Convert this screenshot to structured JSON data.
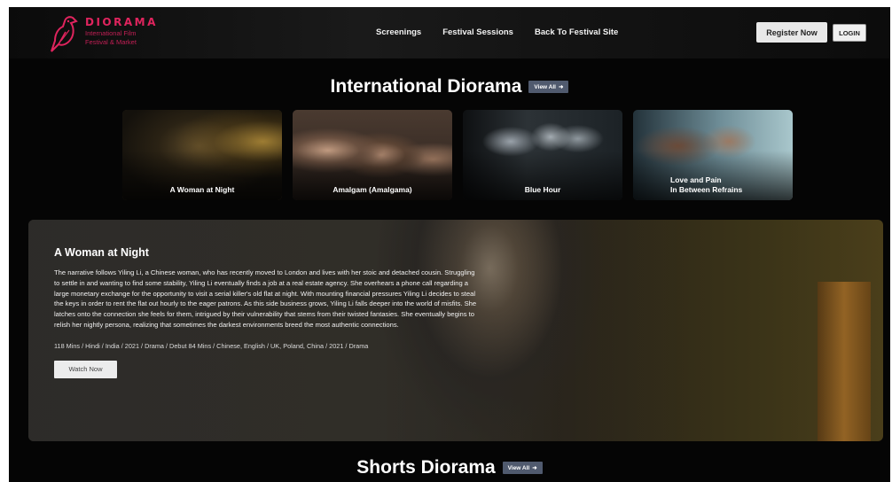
{
  "brand": {
    "name": "DIORAMA",
    "subtitle_line1": "International Film",
    "subtitle_line2": "Festival & Market",
    "accent_color": "#e0245e"
  },
  "nav": {
    "items": [
      {
        "label": "Screenings"
      },
      {
        "label": "Festival Sessions"
      },
      {
        "label": "Back To Festival Site"
      }
    ],
    "register_label": "Register Now",
    "login_label": "LOGIN"
  },
  "sections": {
    "international": {
      "title": "International Diorama",
      "view_all": "View All"
    },
    "shorts": {
      "title": "Shorts Diorama",
      "view_all": "View All"
    }
  },
  "films": [
    {
      "title": "A Woman at Night"
    },
    {
      "title": "Amalgam (Amalgama)"
    },
    {
      "title": "Blue Hour"
    },
    {
      "title_line1": "Love and Pain",
      "title_line2": "In Between Refrains"
    }
  ],
  "feature": {
    "title": "A Woman at Night",
    "description": "The narrative follows Yiling Li, a Chinese woman, who has recently moved to London and lives with her stoic and detached cousin. Struggling to settle in and wanting to find some stability, Yiling Li eventually finds a job at a real estate agency. She overhears a phone call regarding a large monetary exchange for the opportunity to visit a serial killer's old flat at night. With mounting financial pressures Yiling Li decides to steal the keys in order to rent the flat out hourly to the eager patrons. As this side business grows, Yiling Li falls deeper into the world of misfits. She latches onto the connection she feels for them, intrigued by their vulnerability that stems from their twisted fantasies. She eventually begins to relish her nightly persona, realizing that sometimes the darkest environments breed the most authentic connections.",
    "meta": "118 Mins / Hindi / India / 2021 / Drama / Debut 84 Mins / Chinese, English / UK, Poland, China / 2021 / Drama",
    "watch_label": "Watch Now"
  },
  "icons": {
    "logo": "bird-logo-icon",
    "view_all": "arrow-right-icon"
  }
}
